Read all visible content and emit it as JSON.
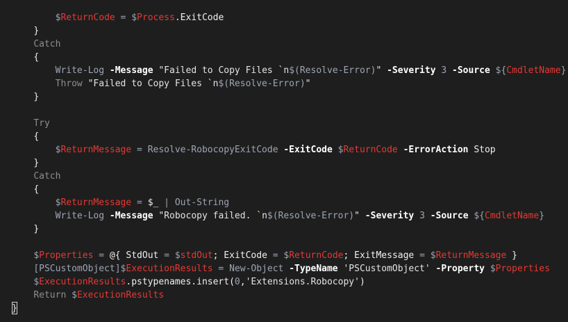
{
  "editor": {
    "lines": [
      {
        "indent": "        ",
        "tokens": [
          {
            "t": "$",
            "c": "t-gray"
          },
          {
            "t": "ReturnCode",
            "c": "t-red"
          },
          {
            "t": " = ",
            "c": "t-gray"
          },
          {
            "t": "$",
            "c": "t-gray"
          },
          {
            "t": "Process",
            "c": "t-red"
          },
          {
            "t": ".ExitCode",
            "c": "t-white"
          }
        ]
      },
      {
        "indent": "    ",
        "tokens": [
          {
            "t": "}",
            "c": "t-white"
          }
        ]
      },
      {
        "indent": "    ",
        "tokens": [
          {
            "t": "Catch",
            "c": "t-kw"
          }
        ]
      },
      {
        "indent": "    ",
        "tokens": [
          {
            "t": "{",
            "c": "t-white"
          }
        ]
      },
      {
        "indent": "        ",
        "tokens": [
          {
            "t": "Write-Log ",
            "c": "t-gray"
          },
          {
            "t": "-Message ",
            "c": "t-bold"
          },
          {
            "t": "\"Failed to Copy Files `n",
            "c": "t-str"
          },
          {
            "t": "$(Resolve-Error)",
            "c": "t-gray"
          },
          {
            "t": "\" ",
            "c": "t-str"
          },
          {
            "t": "-Severity ",
            "c": "t-bold"
          },
          {
            "t": "3 ",
            "c": "t-gray"
          },
          {
            "t": "-Source ",
            "c": "t-bold"
          },
          {
            "t": "${",
            "c": "t-gray"
          },
          {
            "t": "CmdletName",
            "c": "t-red"
          },
          {
            "t": "}",
            "c": "t-gray"
          }
        ]
      },
      {
        "indent": "        ",
        "tokens": [
          {
            "t": "Throw ",
            "c": "t-kw"
          },
          {
            "t": "\"Failed to Copy Files `n",
            "c": "t-str"
          },
          {
            "t": "$(Resolve-Error)",
            "c": "t-gray"
          },
          {
            "t": "\"",
            "c": "t-str"
          }
        ]
      },
      {
        "indent": "    ",
        "tokens": [
          {
            "t": "}",
            "c": "t-white"
          }
        ]
      },
      {
        "indent": "",
        "tokens": []
      },
      {
        "indent": "    ",
        "tokens": [
          {
            "t": "Try",
            "c": "t-kw"
          }
        ]
      },
      {
        "indent": "    ",
        "tokens": [
          {
            "t": "{",
            "c": "t-white"
          }
        ]
      },
      {
        "indent": "        ",
        "tokens": [
          {
            "t": "$",
            "c": "t-gray"
          },
          {
            "t": "ReturnMessage",
            "c": "t-red"
          },
          {
            "t": " = ",
            "c": "t-gray"
          },
          {
            "t": "Resolve-RobocopyExitCode ",
            "c": "t-gray"
          },
          {
            "t": "-ExitCode ",
            "c": "t-bold"
          },
          {
            "t": "$",
            "c": "t-gray"
          },
          {
            "t": "ReturnCode",
            "c": "t-red"
          },
          {
            "t": " ",
            "c": "t-gray"
          },
          {
            "t": "-ErrorAction ",
            "c": "t-bold"
          },
          {
            "t": "Stop",
            "c": "t-white"
          }
        ]
      },
      {
        "indent": "    ",
        "tokens": [
          {
            "t": "}",
            "c": "t-white"
          }
        ]
      },
      {
        "indent": "    ",
        "tokens": [
          {
            "t": "Catch",
            "c": "t-kw"
          }
        ]
      },
      {
        "indent": "    ",
        "tokens": [
          {
            "t": "{",
            "c": "t-white"
          }
        ]
      },
      {
        "indent": "        ",
        "tokens": [
          {
            "t": "$",
            "c": "t-gray"
          },
          {
            "t": "ReturnMessage",
            "c": "t-red"
          },
          {
            "t": " = ",
            "c": "t-gray"
          },
          {
            "t": "$_",
            "c": "t-white"
          },
          {
            "t": " | ",
            "c": "t-gray"
          },
          {
            "t": "Out-String",
            "c": "t-gray"
          }
        ]
      },
      {
        "indent": "        ",
        "tokens": [
          {
            "t": "Write-Log ",
            "c": "t-gray"
          },
          {
            "t": "-Message ",
            "c": "t-bold"
          },
          {
            "t": "\"Robocopy failed. `n",
            "c": "t-str"
          },
          {
            "t": "$(Resolve-Error)",
            "c": "t-gray"
          },
          {
            "t": "\" ",
            "c": "t-str"
          },
          {
            "t": "-Severity ",
            "c": "t-bold"
          },
          {
            "t": "3 ",
            "c": "t-gray"
          },
          {
            "t": "-Source ",
            "c": "t-bold"
          },
          {
            "t": "${",
            "c": "t-gray"
          },
          {
            "t": "CmdletName",
            "c": "t-red"
          },
          {
            "t": "}",
            "c": "t-gray"
          }
        ]
      },
      {
        "indent": "    ",
        "tokens": [
          {
            "t": "}",
            "c": "t-white"
          }
        ]
      },
      {
        "indent": "",
        "tokens": []
      },
      {
        "indent": "    ",
        "tokens": [
          {
            "t": "$",
            "c": "t-gray"
          },
          {
            "t": "Properties",
            "c": "t-red"
          },
          {
            "t": " = ",
            "c": "t-gray"
          },
          {
            "t": "@{ StdOut ",
            "c": "t-white"
          },
          {
            "t": "= ",
            "c": "t-gray"
          },
          {
            "t": "$",
            "c": "t-gray"
          },
          {
            "t": "stdOut",
            "c": "t-red"
          },
          {
            "t": "; ExitCode ",
            "c": "t-white"
          },
          {
            "t": "= ",
            "c": "t-gray"
          },
          {
            "t": "$",
            "c": "t-gray"
          },
          {
            "t": "ReturnCode",
            "c": "t-red"
          },
          {
            "t": "; ExitMessage ",
            "c": "t-white"
          },
          {
            "t": "= ",
            "c": "t-gray"
          },
          {
            "t": "$",
            "c": "t-gray"
          },
          {
            "t": "ReturnMessage",
            "c": "t-red"
          },
          {
            "t": " }",
            "c": "t-white"
          }
        ]
      },
      {
        "indent": "    ",
        "tokens": [
          {
            "t": "[PSCustomObject]",
            "c": "t-gray"
          },
          {
            "t": "$",
            "c": "t-gray"
          },
          {
            "t": "ExecutionResults",
            "c": "t-red"
          },
          {
            "t": " = ",
            "c": "t-gray"
          },
          {
            "t": "New-Object ",
            "c": "t-gray"
          },
          {
            "t": "-TypeName ",
            "c": "t-bold"
          },
          {
            "t": "'PSCustomObject' ",
            "c": "t-str"
          },
          {
            "t": "-Property ",
            "c": "t-bold"
          },
          {
            "t": "$",
            "c": "t-gray"
          },
          {
            "t": "Properties",
            "c": "t-red"
          }
        ]
      },
      {
        "indent": "    ",
        "tokens": [
          {
            "t": "$",
            "c": "t-gray"
          },
          {
            "t": "ExecutionResults",
            "c": "t-red"
          },
          {
            "t": ".pstypenames.insert(",
            "c": "t-white"
          },
          {
            "t": "0",
            "c": "t-gray"
          },
          {
            "t": ",",
            "c": "t-white"
          },
          {
            "t": "'Extensions.Robocopy'",
            "c": "t-str"
          },
          {
            "t": ")",
            "c": "t-white"
          }
        ]
      },
      {
        "indent": "    ",
        "tokens": [
          {
            "t": "Return ",
            "c": "t-kw"
          },
          {
            "t": "$",
            "c": "t-gray"
          },
          {
            "t": "ExecutionResults",
            "c": "t-red"
          }
        ]
      },
      {
        "indent": "",
        "tokens": [
          {
            "t": "}",
            "c": "t-white"
          }
        ]
      }
    ]
  }
}
